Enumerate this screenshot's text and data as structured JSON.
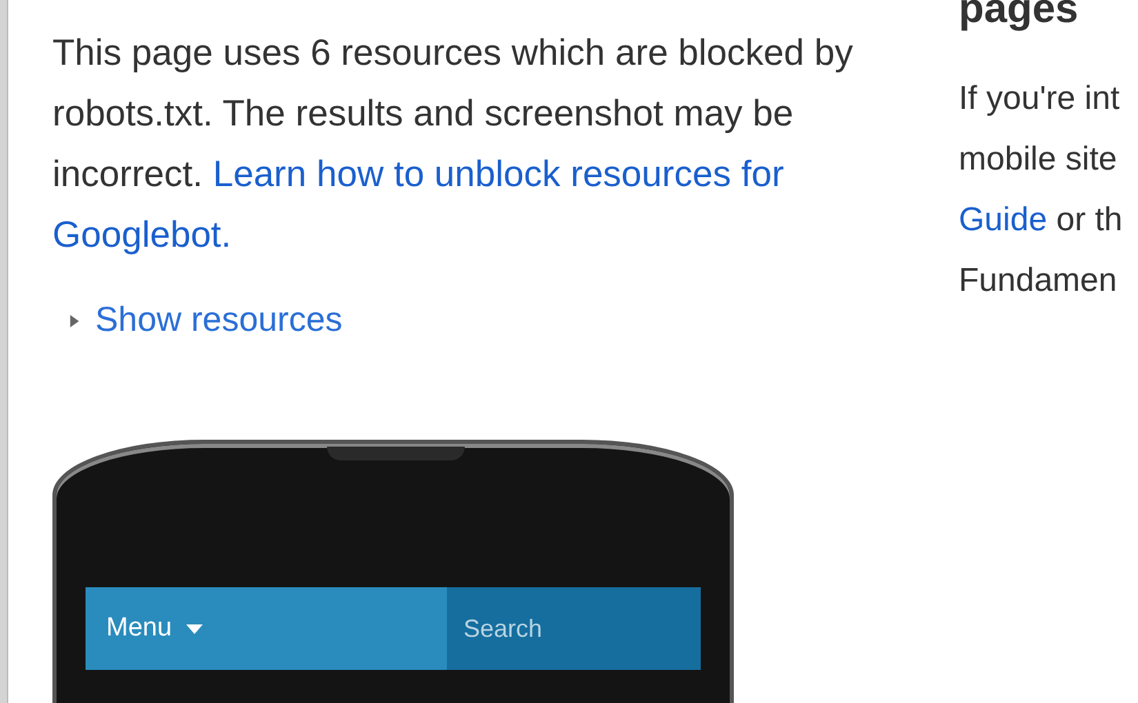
{
  "notice": {
    "text": "This page uses 6 resources which are blocked by robots.txt. The results and screenshot may be incorrect.",
    "links": [
      "Learn how to unblock resources for",
      "Googlebot."
    ]
  },
  "disclosure": {
    "label": "Show resources",
    "expanded": false
  },
  "phone": {
    "menu": "Menu",
    "search": {
      "placeholder": "Search"
    }
  },
  "side": {
    "heading": "pages",
    "lines": [
      {
        "text": "If you're int"
      },
      {
        "text": "mobile site"
      },
      {
        "link": "Guide",
        "text": " or th"
      },
      {
        "text": "Fundamen"
      }
    ]
  }
}
